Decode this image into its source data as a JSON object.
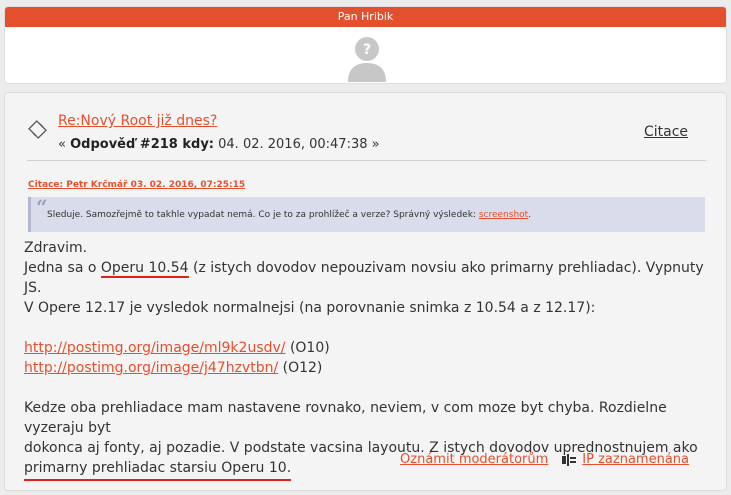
{
  "user": {
    "name": "Pan Hribik",
    "avatar_icon": "unknown-user-avatar-icon"
  },
  "post": {
    "title": "Re:Nový Root již dnes?",
    "meta_prefix": "« ",
    "reply_label": "Odpověď #218 kdy:",
    "date": "04. 02. 2016, 00:47:38",
    "meta_suffix": " »",
    "cite_label": "Citace",
    "quote": {
      "header": "Citace: Petr Krčmář  03. 02. 2016, 07:25:15",
      "text_before": "Sleduje. Samozřejmě to takhle vypadat nemá. Co je to za prohlížeč a verze? Správný výsledek: ",
      "link_text": "screenshot",
      "text_after": "."
    },
    "body": {
      "line1": "Zdravim.",
      "line2_a": "Jedna sa o ",
      "line2_hl": "Operu 10.54",
      "line2_b": " (z istych dovodov nepouzivam novsiu ako primarny prehliadac). Vypnuty JS.",
      "line3": "V Opere 12.17 je vysledok normalnejsi (na porovnanie snimka z 10.54 a z 12.17):",
      "link1": "http://postimg.org/image/ml9k2usdv/",
      "link1_suffix": " (O10)",
      "link2": "http://postimg.org/image/j47hzvtbn/",
      "link2_suffix": " (O12)",
      "para2_a": "Kedze oba prehliadace mam nastavene rovnako, neviem, v com moze byt chyba. Rozdielne vyzeraju byt",
      "para2_b": "dokonca aj fonty, aj pozadie. V podstate vacsina layoutu. Z istych dovodov uprednostnujem ako",
      "para2_c": "primarny prehliadac starsiu Operu 10."
    },
    "footer": {
      "report_label": "Oznámit moderátorům",
      "ip_label": "IP zaznamenána"
    }
  },
  "colors": {
    "accent": "#e4502d",
    "highlight_underline": "#e0201a",
    "quote_bg": "#d9dceb"
  }
}
